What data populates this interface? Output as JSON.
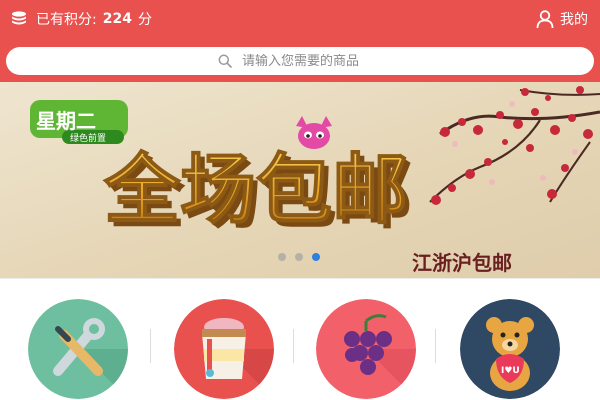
{
  "header": {
    "points_label": "已有积分:",
    "points_value": "224",
    "points_unit": "分",
    "mine_label": "我的",
    "coin_icon": "coin-stack-icon",
    "user_icon": "user-icon"
  },
  "search": {
    "placeholder": "请输入您需要的商品",
    "icon": "search-icon"
  },
  "banner": {
    "brand": "星期二",
    "brand_sub": "绿色前置",
    "headline": "全场包邮",
    "caption": "江浙沪包邮",
    "slides_total": 3,
    "active_slide": 3
  },
  "categories": [
    {
      "icon": "tools-icon",
      "color": "#6dbf9f"
    },
    {
      "icon": "ice-cream-icon",
      "color": "#e9514f"
    },
    {
      "icon": "grapes-icon",
      "color": "#f2606a"
    },
    {
      "icon": "teddy-bear-icon",
      "color": "#2f4863"
    }
  ],
  "colors": {
    "header": "#e9514f",
    "active_dot": "#2d7fe0"
  }
}
